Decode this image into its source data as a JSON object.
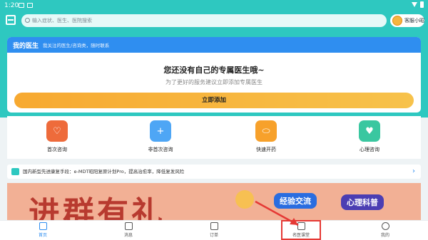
{
  "status": {
    "time": "1:20"
  },
  "search": {
    "placeholder": "输入症状、医生、医院搜索",
    "assistant": "客服小昭"
  },
  "doctor": {
    "title": "我的医生",
    "subtitle": "我关注的医生/咨询类，随时联系",
    "empty": "您还没有自己的专属医生哦~",
    "desc": "为了更好的服务建议立即添加专属医生",
    "add": "立即添加"
  },
  "services": [
    {
      "label": "首次咨询",
      "color": "#ee6b3b",
      "icon": "stethoscope-icon"
    },
    {
      "label": "非首次咨询",
      "color": "#4ea6f5",
      "icon": "medical-kit-icon"
    },
    {
      "label": "快速开药",
      "color": "#f7a12b",
      "icon": "pill-icon"
    },
    {
      "label": "心理咨询",
      "color": "#3ac7a0",
      "icon": "heart-icon"
    }
  ],
  "notice": {
    "text": "国内新型先进康复手段：e-MDT昭阳复原计划Pro，提高治愈率，降低复发风险"
  },
  "banner": {
    "headline": "进群有礼",
    "tag1": "经验交流",
    "tag2": "心理科普"
  },
  "tabs": [
    {
      "label": "首页"
    },
    {
      "label": "消息"
    },
    {
      "label": "订单"
    },
    {
      "label": "名医课堂"
    },
    {
      "label": "我的"
    }
  ]
}
